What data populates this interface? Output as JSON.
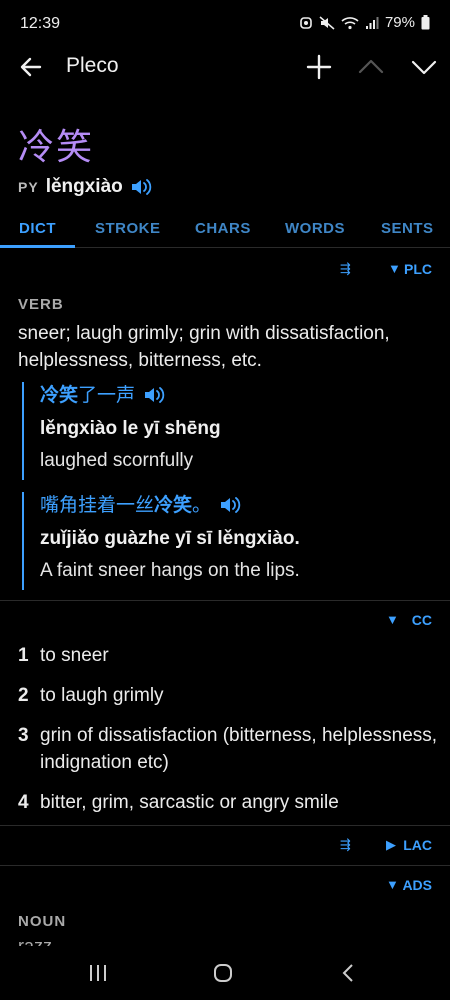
{
  "status": {
    "time": "12:39",
    "battery": "79%"
  },
  "appbar": {
    "title": "Pleco"
  },
  "entry": {
    "headword": "冷笑",
    "py_label": "PY",
    "pinyin": "lěngxiào"
  },
  "tabs": [
    {
      "label": "DICT"
    },
    {
      "label": "STROKE"
    },
    {
      "label": "CHARS"
    },
    {
      "label": "WORDS"
    },
    {
      "label": "SENTS"
    }
  ],
  "plc": {
    "source": "PLC",
    "pos": "VERB",
    "definition": "sneer; laugh grimly; grin with dissatisfaction, helplessness, bitterness, etc.",
    "examples": [
      {
        "hanzi_bold": "冷笑",
        "hanzi_rest": "了一声",
        "pinyin": "lěngxiào le yī shēng",
        "translation": "laughed scornfully"
      },
      {
        "hanzi_pre": "嘴角挂着一丝",
        "hanzi_bold": "冷笑",
        "hanzi_post": "。",
        "pinyin_pre": "zuǐjiǎo guàzhe yī sī ",
        "pinyin_bold": "lěngxiào",
        "pinyin_post": ".",
        "translation": "A faint sneer hangs on the lips."
      }
    ]
  },
  "cc": {
    "source": "CC",
    "items": [
      {
        "num": "1",
        "text": "to sneer"
      },
      {
        "num": "2",
        "text": "to laugh grimly"
      },
      {
        "num": "3",
        "text": "grin of dissatisfaction (bitterness, helplessness, indignation etc)"
      },
      {
        "num": "4",
        "text": "bitter, grim, sarcastic or angry smile"
      }
    ]
  },
  "lac": {
    "source": "LAC"
  },
  "ads": {
    "source": "ADS",
    "pos": "NOUN",
    "cut_text": "razz"
  },
  "colors": {
    "accent": "#3da0ff",
    "headword": "#b58cf5",
    "background": "#000000"
  }
}
